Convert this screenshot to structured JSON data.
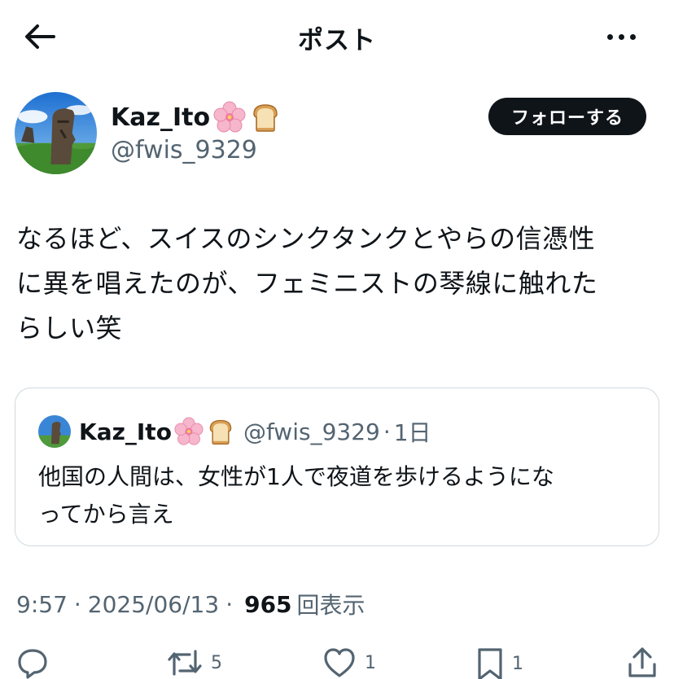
{
  "header": {
    "title": "ポスト"
  },
  "author": {
    "name": "Kaz_Ito",
    "name_emojis": [
      "cherry-blossom-icon",
      "bread-icon"
    ],
    "handle": "@fwis_9329",
    "follow_label": "フォローする"
  },
  "post": {
    "text": "なるほど、スイスのシンクタンクとやらの信憑性\nに異を唱えたのが、フェミニストの琴線に触れた\nらしい笑"
  },
  "quote": {
    "name": "Kaz_Ito",
    "handle": "@fwis_9329",
    "separator": "·",
    "time": "1日",
    "text": "他国の人間は、女性が1人で夜道を歩けるようにな\nってから言え"
  },
  "meta": {
    "time": "9:57",
    "sep1": "·",
    "date": "2025/06/13",
    "sep2": "·",
    "views_count": "965",
    "views_label": "回表示"
  },
  "actions": {
    "reply_count": "",
    "repost_count": "5",
    "like_count": "1",
    "bookmark_count": "1"
  },
  "colors": {
    "text": "#0f1419",
    "secondary": "#536471",
    "border": "#cfd9de",
    "follow_bg": "#0f1419"
  }
}
